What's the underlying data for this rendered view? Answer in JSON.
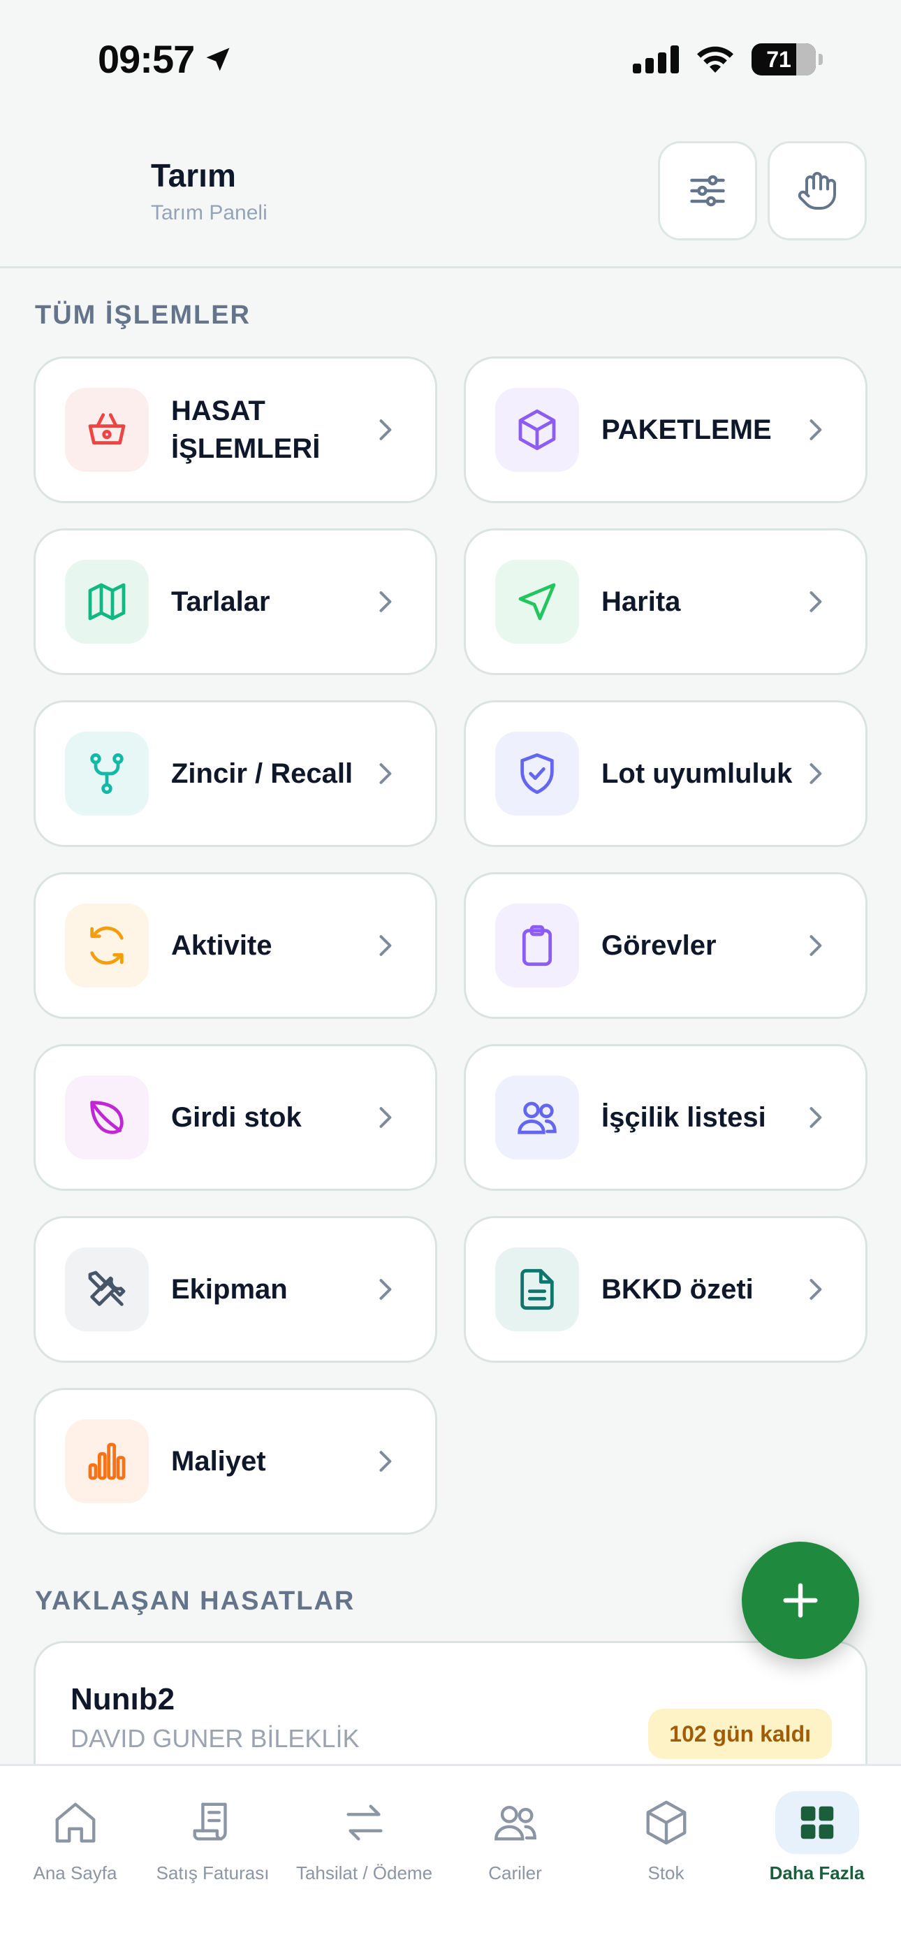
{
  "status": {
    "time": "09:57",
    "battery": "71"
  },
  "header": {
    "title": "Tarım",
    "subtitle": "Tarım Paneli"
  },
  "sections": {
    "all_ops": "TÜM İŞLEMLER",
    "upcoming": "YAKLAŞAN HASATLAR"
  },
  "tiles": [
    {
      "label": "HASAT İŞLEMLERİ",
      "icon": "basket-icon",
      "color": "#ef4444",
      "bg": "#fdeeee"
    },
    {
      "label": "PAKETLEME",
      "icon": "box-icon",
      "color": "#8b5cf6",
      "bg": "#f3efff"
    },
    {
      "label": "Tarlalar",
      "icon": "map-icon",
      "color": "#10b981",
      "bg": "#e7f7f0"
    },
    {
      "label": "Harita",
      "icon": "navigation-icon",
      "color": "#22c55e",
      "bg": "#e9f8ee"
    },
    {
      "label": "Zincir / Recall",
      "icon": "branch-icon",
      "color": "#14b8a6",
      "bg": "#e6f7f5"
    },
    {
      "label": "Lot uyumluluk",
      "icon": "shield-check-icon",
      "color": "#6366f1",
      "bg": "#eef0fd"
    },
    {
      "label": "Aktivite",
      "icon": "refresh-icon",
      "color": "#f59e0b",
      "bg": "#fff5e6"
    },
    {
      "label": "Görevler",
      "icon": "clipboard-icon",
      "color": "#8b5cf6",
      "bg": "#f3efff"
    },
    {
      "label": "Girdi stok",
      "icon": "leaf-icon",
      "color": "#c026d3",
      "bg": "#faf0fc"
    },
    {
      "label": "İşçilik listesi",
      "icon": "users-icon",
      "color": "#6366f1",
      "bg": "#eef0fd"
    },
    {
      "label": "Ekipman",
      "icon": "tools-icon",
      "color": "#475569",
      "bg": "#f0f2f4"
    },
    {
      "label": "BKKD özeti",
      "icon": "document-icon",
      "color": "#0f766e",
      "bg": "#e7f3f1"
    },
    {
      "label": "Maliyet",
      "icon": "bar-chart-icon",
      "color": "#f97316",
      "bg": "#fff0e8"
    }
  ],
  "upcoming_harvest": {
    "name": "Nunıb2",
    "sub": "DAVID GUNER BİLEKLİK",
    "badge": "102 gün kaldı"
  },
  "nav": [
    {
      "label": "Ana Sayfa",
      "icon": "home-icon"
    },
    {
      "label": "Satış Faturası",
      "icon": "invoice-icon"
    },
    {
      "label": "Tahsilat / Ödeme",
      "icon": "transfer-icon"
    },
    {
      "label": "Cariler",
      "icon": "users-icon"
    },
    {
      "label": "Stok",
      "icon": "box-icon"
    },
    {
      "label": "Daha Fazla",
      "icon": "grid-icon"
    }
  ],
  "colors": {
    "accent": "#1f8a3e",
    "active_nav": "#1b5e3b"
  }
}
